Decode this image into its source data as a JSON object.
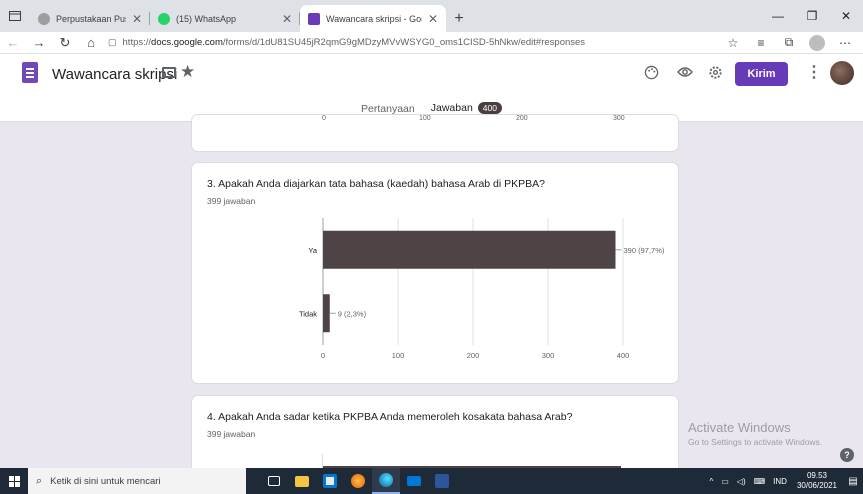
{
  "browser": {
    "tabs": [
      {
        "title": "Perpustakaan Pusat",
        "favicon_color": "#9e9e9e",
        "active": false
      },
      {
        "title": "(15) WhatsApp",
        "favicon_color": "#25d366",
        "active": false
      },
      {
        "title": "Wawancara skripsi - Google Forr",
        "favicon_color": "#673ab7",
        "active": true
      }
    ],
    "new_tab_icon": "+",
    "url_prefix": "https://",
    "url_domain": "docs.google.com",
    "url_path": "/forms/d/1dU81SU45jR2qmG9gMDzyMVvWSYG0_oms1CISD-5hNkw/edit#responses"
  },
  "form": {
    "title": "Wawancara skripsi",
    "send_label": "Kirim",
    "tabs": {
      "questions": "Pertanyaan",
      "responses": "Jawaban",
      "response_count": "400"
    },
    "accent_color": "#673ab7"
  },
  "prev_axis_ticks": [
    "0",
    "100",
    "200",
    "300"
  ],
  "questions": [
    {
      "title": "3. Apakah Anda diajarkan tata bahasa (kaedah) bahasa Arab di PKPBA?",
      "count": "399 jawaban"
    },
    {
      "title": "4. Apakah Anda sadar ketika PKPBA Anda memeroleh kosakata bahasa Arab?",
      "count": "399 jawaban"
    }
  ],
  "chart_data": {
    "type": "bar",
    "orientation": "horizontal",
    "categories": [
      "Ya",
      "Tidak"
    ],
    "values": [
      390,
      9
    ],
    "data_labels": [
      "390 (97,7%)",
      "9 (2,3%)"
    ],
    "xlim": [
      0,
      400
    ],
    "x_ticks": [
      "0",
      "100",
      "200",
      "300",
      "400"
    ],
    "bar_color": "#4e4445",
    "grid": true
  },
  "watermark": {
    "line1": "Activate Windows",
    "line2": "Go to Settings to activate Windows."
  },
  "taskbar": {
    "search_placeholder": "Ketik di sini untuk mencari",
    "language": "IND",
    "time": "09.53",
    "date": "30/06/2021"
  }
}
